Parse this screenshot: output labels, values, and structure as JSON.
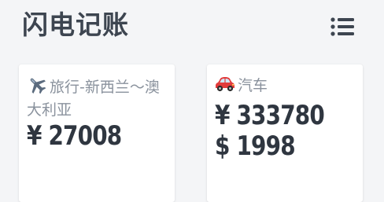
{
  "header": {
    "title": "闪电记账",
    "menu_icon": "list-menu-icon"
  },
  "cards": [
    {
      "icon": "airplane-icon",
      "label": "旅行-新西兰～澳大利亚",
      "amounts": [
        "¥ 27008"
      ]
    },
    {
      "icon": "car-icon",
      "label": "汽车",
      "amounts": [
        "¥ 333780",
        "$ 1998"
      ]
    }
  ],
  "colors": {
    "background": "#f4f5f7",
    "card": "#ffffff",
    "title": "#3d4550",
    "label": "#8a929d",
    "amount": "#2f3640"
  }
}
